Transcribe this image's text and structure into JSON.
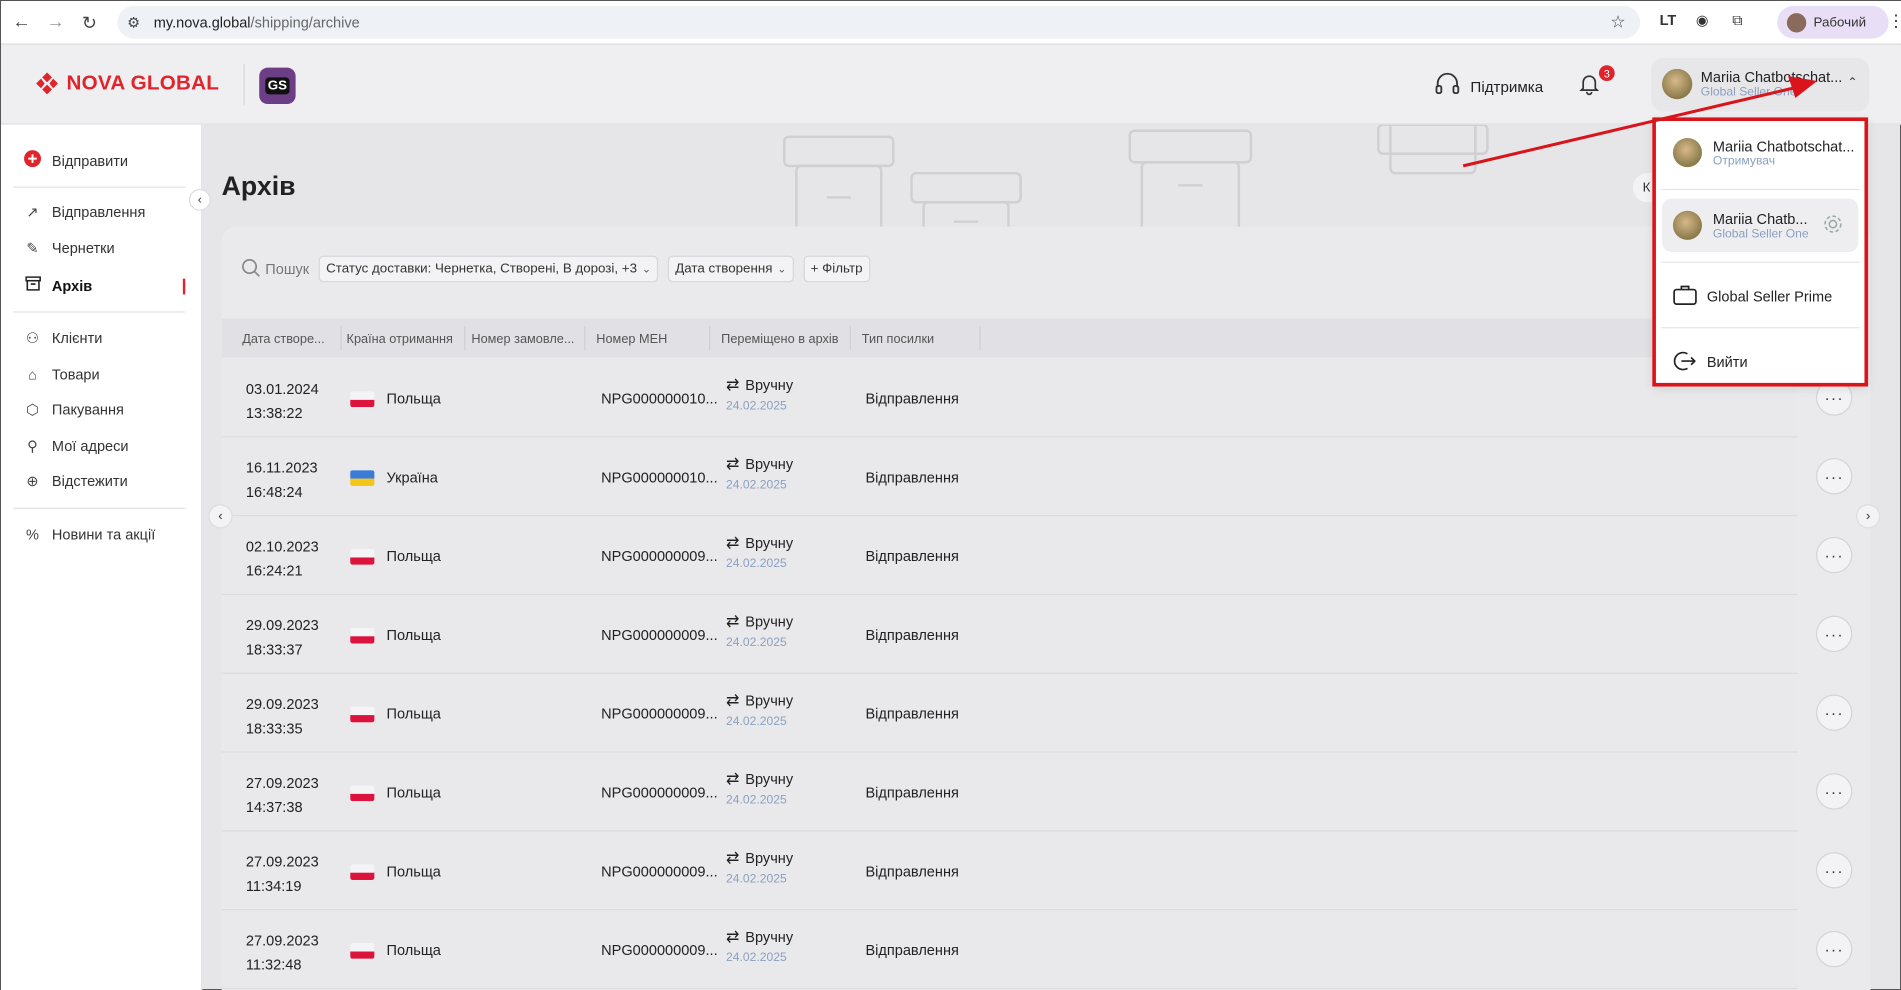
{
  "browser": {
    "url_host": "my.nova.global",
    "url_path": "/shipping/archive",
    "profile_label": "Рабочий",
    "ext_label": "LT"
  },
  "header": {
    "logo_text": "NOVA GLOBAL",
    "gs_badge": "GS",
    "support_label": "Підтримка",
    "notifications_count": "3",
    "user_name": "Mariia Chatbotschat...",
    "user_role": "Global Seller One"
  },
  "sidebar": {
    "send_label": "Відправити",
    "items_group1": [
      {
        "label": "Відправлення"
      },
      {
        "label": "Чернетки"
      },
      {
        "label": "Архів"
      }
    ],
    "items_group2": [
      {
        "label": "Клієнти"
      },
      {
        "label": "Товари"
      },
      {
        "label": "Пакування"
      },
      {
        "label": "Мої адреси"
      },
      {
        "label": "Відстежити"
      }
    ],
    "items_group3": [
      {
        "label": "Новини та акції"
      }
    ]
  },
  "page": {
    "title": "Архів",
    "k_button": "К"
  },
  "toolbar": {
    "search_placeholder": "Пошук",
    "status_filter": "Статус доставки: Чернетка, Створені, В дорозі, +3",
    "date_filter": "Дата створення",
    "add_filter": "+ Фільтр"
  },
  "table": {
    "columns": [
      "Дата створе...",
      "Країна отримання",
      "Номер замовле...",
      "Номер МЕН",
      "Переміщено в архів",
      "Тип посилки"
    ],
    "rows": [
      {
        "date": "03.01.2024",
        "time": "13:38:22",
        "country": "Польща",
        "flag": "pl",
        "mew": "NPG000000010...",
        "moved": "Вручну",
        "moved_date": "24.02.2025",
        "type": "Відправлення"
      },
      {
        "date": "16.11.2023",
        "time": "16:48:24",
        "country": "Україна",
        "flag": "ua",
        "mew": "NPG000000010...",
        "moved": "Вручну",
        "moved_date": "24.02.2025",
        "type": "Відправлення"
      },
      {
        "date": "02.10.2023",
        "time": "16:24:21",
        "country": "Польща",
        "flag": "pl",
        "mew": "NPG000000009...",
        "moved": "Вручну",
        "moved_date": "24.02.2025",
        "type": "Відправлення"
      },
      {
        "date": "29.09.2023",
        "time": "18:33:37",
        "country": "Польща",
        "flag": "pl",
        "mew": "NPG000000009...",
        "moved": "Вручну",
        "moved_date": "24.02.2025",
        "type": "Відправлення"
      },
      {
        "date": "29.09.2023",
        "time": "18:33:35",
        "country": "Польща",
        "flag": "pl",
        "mew": "NPG000000009...",
        "moved": "Вручну",
        "moved_date": "24.02.2025",
        "type": "Відправлення"
      },
      {
        "date": "27.09.2023",
        "time": "14:37:38",
        "country": "Польща",
        "flag": "pl",
        "mew": "NPG000000009...",
        "moved": "Вручну",
        "moved_date": "24.02.2025",
        "type": "Відправлення"
      },
      {
        "date": "27.09.2023",
        "time": "11:34:19",
        "country": "Польща",
        "flag": "pl",
        "mew": "NPG000000009...",
        "moved": "Вручну",
        "moved_date": "24.02.2025",
        "type": "Відправлення"
      },
      {
        "date": "27.09.2023",
        "time": "11:32:48",
        "country": "Польща",
        "flag": "pl",
        "mew": "NPG000000009...",
        "moved": "Вручну",
        "moved_date": "24.02.2025",
        "type": "Відправлення"
      }
    ]
  },
  "dropdown": {
    "account1_name": "Mariia Chatbotschat...",
    "account1_role": "Отримувач",
    "account2_name": "Mariia Chatb...",
    "account2_role": "Global Seller One",
    "prime_label": "Global Seller Prime",
    "logout_label": "Вийти"
  },
  "colors": {
    "brand_red": "#e0242b",
    "highlight_red": "#d9141b",
    "muted_blue": "#8aa0c0"
  }
}
